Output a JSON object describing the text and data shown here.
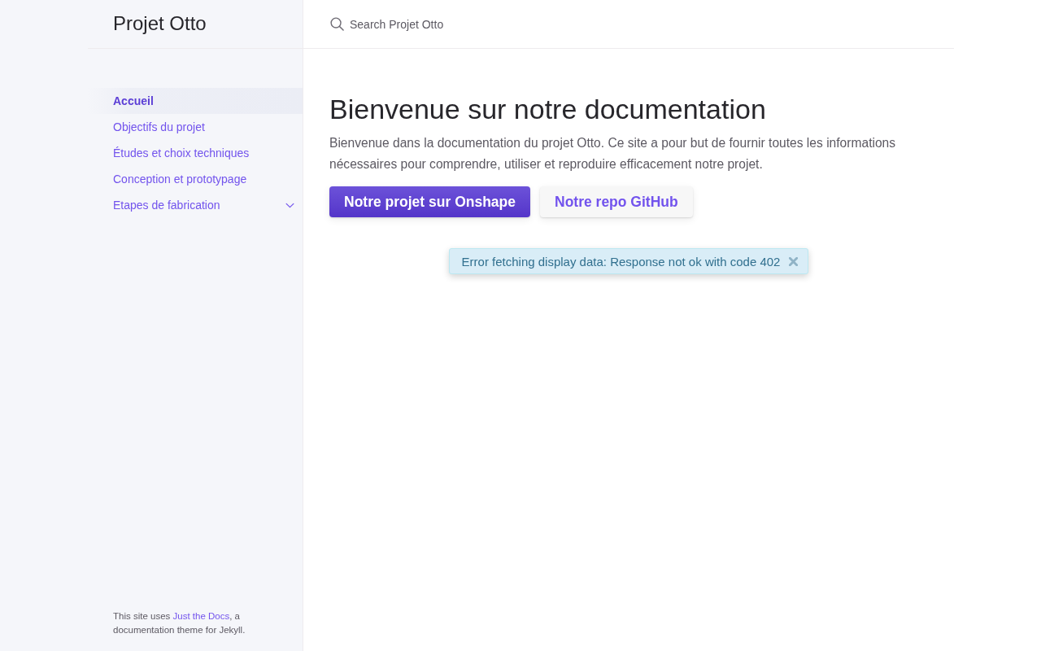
{
  "sidebar": {
    "site_title": "Projet Otto",
    "nav_items": [
      {
        "label": "Accueil",
        "selected": true,
        "expandable": false
      },
      {
        "label": "Objectifs du projet",
        "selected": false,
        "expandable": false
      },
      {
        "label": "Études et choix techniques",
        "selected": false,
        "expandable": false
      },
      {
        "label": "Conception et prototypage",
        "selected": false,
        "expandable": false
      },
      {
        "label": "Etapes de fabrication",
        "selected": false,
        "expandable": true,
        "expanded": false
      }
    ],
    "footer": {
      "before": "This site uses ",
      "link": "Just the Docs",
      "after": ", a documentation theme for Jekyll."
    }
  },
  "search": {
    "placeholder": "Search Projet Otto"
  },
  "main": {
    "heading": "Bienvenue sur notre documentation",
    "intro": "Bienvenue dans la documentation du projet Otto. Ce site a pour but de fournir toutes les informations nécessaires pour comprendre, utiliser et reproduire efficacement notre projet.",
    "buttons": [
      {
        "label": "Notre projet sur Onshape",
        "kind": "primary"
      },
      {
        "label": "Notre repo GitHub",
        "kind": "secondary"
      }
    ]
  },
  "alert": {
    "message": "Error fetching display data: Response not ok with code 402",
    "dismissible": true
  }
}
